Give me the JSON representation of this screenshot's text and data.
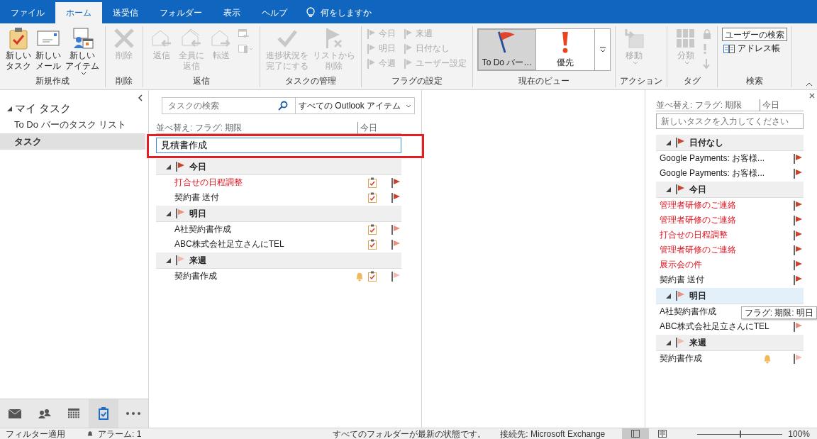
{
  "tabs": [
    {
      "label": "ファイル",
      "selected": false
    },
    {
      "label": "ホーム",
      "selected": true
    },
    {
      "label": "送受信",
      "selected": false
    },
    {
      "label": "フォルダー",
      "selected": false
    },
    {
      "label": "表示",
      "selected": false
    },
    {
      "label": "ヘルプ",
      "selected": false
    }
  ],
  "tell_me": "何をしますか",
  "ribbon": {
    "groups": [
      {
        "kind": "buttons",
        "label": "新規作成",
        "large": [
          {
            "kind": "task",
            "lines": [
              "新しい",
              "タスク"
            ],
            "disabled": false,
            "dropdown": false
          },
          {
            "kind": "mail",
            "lines": [
              "新しい",
              "メール"
            ],
            "disabled": false,
            "dropdown": false
          },
          {
            "kind": "item",
            "lines": [
              "新しい",
              "アイテム"
            ],
            "disabled": false,
            "dropdown": true
          }
        ]
      },
      {
        "kind": "buttons",
        "label": "削除",
        "large": [
          {
            "kind": "delete",
            "lines": [
              "削除"
            ],
            "disabled": true,
            "dropdown": false
          }
        ]
      },
      {
        "kind": "buttons",
        "label": "返信",
        "large": [
          {
            "kind": "reply",
            "lines": [
              "返信"
            ],
            "disabled": true,
            "dropdown": false
          },
          {
            "kind": "replyall",
            "lines": [
              "全員に",
              "返信"
            ],
            "disabled": true,
            "dropdown": false
          },
          {
            "kind": "forward",
            "lines": [
              "転送"
            ],
            "disabled": true,
            "dropdown": false
          }
        ],
        "small": [
          {
            "kind": "meeting",
            "disabled": true
          },
          {
            "kind": "more",
            "disabled": true
          }
        ]
      },
      {
        "kind": "buttons",
        "label": "タスクの管理",
        "large": [
          {
            "kind": "complete",
            "lines": [
              "進捗状況を",
              "完了にする"
            ],
            "disabled": true,
            "dropdown": false
          },
          {
            "kind": "unflag",
            "lines": [
              "リストから",
              "削除"
            ],
            "disabled": true,
            "dropdown": false
          }
        ]
      },
      {
        "kind": "buttons",
        "label": "フラグの設定",
        "small": [
          {
            "kind": "flag",
            "label": "今日",
            "disabled": true
          },
          {
            "kind": "flag",
            "label": "明日",
            "disabled": true
          },
          {
            "kind": "flag",
            "label": "今週",
            "disabled": true
          },
          {
            "kind": "flag",
            "label": "来週",
            "disabled": true
          },
          {
            "kind": "flag",
            "label": "日付なし",
            "disabled": true
          },
          {
            "kind": "flag",
            "label": "ユーザー設定",
            "disabled": true
          }
        ]
      },
      {
        "kind": "gallery",
        "label": "現在のビュー",
        "views": [
          {
            "kind": "todo",
            "label": "To Do バー…",
            "selected": true
          },
          {
            "kind": "priority",
            "label": "優先",
            "selected": false
          }
        ]
      },
      {
        "kind": "buttons",
        "label": "アクション",
        "large": [
          {
            "kind": "move",
            "lines": [
              "移動"
            ],
            "disabled": true,
            "dropdown": true
          }
        ]
      },
      {
        "kind": "buttons",
        "label": "タグ",
        "large": [
          {
            "kind": "categorize",
            "lines": [
              "分類"
            ],
            "disabled": true,
            "dropdown": true
          }
        ],
        "small": [
          {
            "kind": "lock",
            "disabled": true
          },
          {
            "kind": "important",
            "disabled": true
          },
          {
            "kind": "low",
            "disabled": true
          }
        ]
      },
      {
        "kind": "buttons",
        "label": "検索",
        "small": [
          {
            "kind": "field",
            "label": "ユーザーの検索",
            "disabled": false
          },
          {
            "kind": "book",
            "label": "アドレス帳",
            "disabled": false
          }
        ]
      }
    ]
  },
  "nav": {
    "header": {
      "label": "マイ タスク",
      "expanded": true
    },
    "items": [
      {
        "label": "To Do バーのタスク リスト",
        "selected": false
      },
      {
        "label": "タスク",
        "selected": true
      }
    ],
    "modules": [
      {
        "kind": "mail",
        "selected": false
      },
      {
        "kind": "people",
        "selected": false
      },
      {
        "kind": "calendar",
        "selected": false
      },
      {
        "kind": "tasks",
        "selected": true
      },
      {
        "kind": "more",
        "selected": false
      }
    ]
  },
  "tasks": {
    "search": {
      "placeholder": "タスクの検索"
    },
    "scope": "すべての Outlook アイテム",
    "sort": {
      "label": "並べ替え: フラグ: 期限",
      "value": "今日"
    },
    "new_task": {
      "value": "見積書作成"
    },
    "groups": [
      {
        "label": "今日",
        "color": "#c8452c",
        "expanded": true,
        "highlighted": false,
        "items": [
          {
            "title": "打合せの日程調整",
            "overdue": true,
            "reminder": false
          },
          {
            "title": "契約書  送付",
            "overdue": false,
            "reminder": false
          }
        ]
      },
      {
        "label": "明日",
        "color": "#e8907e",
        "expanded": true,
        "highlighted": false,
        "items": [
          {
            "title": "A社契約書作成",
            "overdue": false,
            "reminder": false
          },
          {
            "title": "ABC株式会社足立さんにTEL",
            "overdue": false,
            "reminder": false
          }
        ]
      },
      {
        "label": "来週",
        "color": "#f2b8ad",
        "expanded": true,
        "highlighted": false,
        "items": [
          {
            "title": "契約書作成",
            "overdue": false,
            "reminder": true
          }
        ]
      }
    ]
  },
  "todo": {
    "sort": {
      "label": "並べ替え: フラグ: 期限",
      "value": "今日"
    },
    "new_task": {
      "placeholder": "新しいタスクを入力してください"
    },
    "groups": [
      {
        "label": "日付なし",
        "color": "#c8452c",
        "expanded": true,
        "highlighted": false,
        "items": [
          {
            "title": "Google Payments: お客様...",
            "overdue": false,
            "reminder": false
          },
          {
            "title": "Google Payments: お客様...",
            "overdue": false,
            "reminder": false
          }
        ]
      },
      {
        "label": "今日",
        "color": "#c8452c",
        "expanded": true,
        "highlighted": false,
        "items": [
          {
            "title": "管理者研修のご連絡",
            "overdue": true,
            "reminder": false
          },
          {
            "title": "管理者研修のご連絡",
            "overdue": true,
            "reminder": false
          },
          {
            "title": "打合せの日程調整",
            "overdue": true,
            "reminder": false
          },
          {
            "title": "管理者研修のご連絡",
            "overdue": true,
            "reminder": false
          },
          {
            "title": "展示会の件",
            "overdue": true,
            "reminder": false
          },
          {
            "title": "契約書  送付",
            "overdue": false,
            "reminder": false
          }
        ]
      },
      {
        "label": "明日",
        "color": "#e8907e",
        "expanded": true,
        "highlighted": true,
        "items": [
          {
            "title": "A社契約書作成",
            "overdue": false,
            "reminder": false
          },
          {
            "title": "ABC株式会社足立さんにTEL",
            "overdue": false,
            "reminder": false
          }
        ]
      },
      {
        "label": "来週",
        "color": "#f2b8ad",
        "expanded": true,
        "highlighted": false,
        "items": [
          {
            "title": "契約書作成",
            "overdue": false,
            "reminder": true
          }
        ]
      }
    ],
    "tooltip": "フラグ: 期限: 明日"
  },
  "status": {
    "filter": "フィルター適用",
    "alarm": "アラーム: 1",
    "sync": "すべてのフォルダーが最新の状態です。",
    "connection": "接続先: Microsoft Exchange",
    "views": [
      {
        "kind": "normal",
        "selected": true
      },
      {
        "kind": "reading",
        "selected": false
      }
    ],
    "zoom": {
      "level": 0.5,
      "reading": "100%"
    }
  }
}
